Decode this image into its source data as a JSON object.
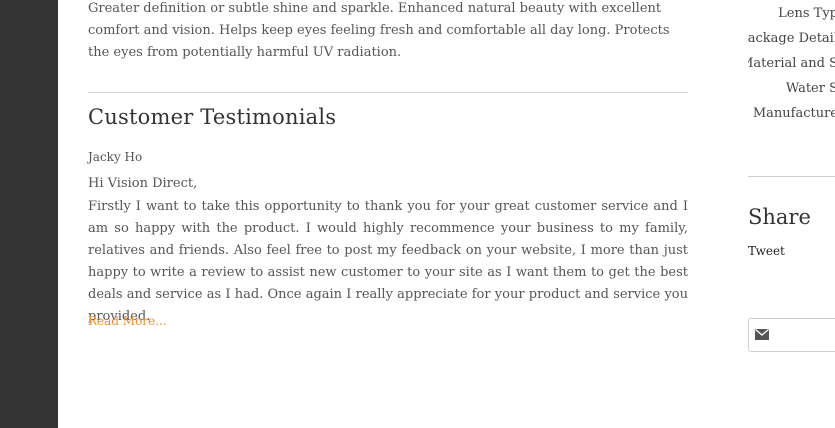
{
  "main": {
    "intro_text": "Greater definition or subtle shine and sparkle. Enhanced natural beauty with excellent comfort and vision. Helps keep eyes feeling fresh and comfortable all day long. Protects the eyes from potentially harmful UV radiation.",
    "section_title": "Customer Testimonials",
    "testimonial": {
      "author": "Jacky Ho",
      "greeting": "Hi Vision Direct,",
      "body": "Firstly I want to take this opportunity to thank you for your great customer service and I am so happy with the product. I would highly recommence your business to my family, relatives and friends. Also feel free to post my feedback on your website, I more than just happy to write a review to assist new customer to your site as I want them to get the best deals and service as I had. Once again I really appreciate for your product and service you provided.",
      "read_more": "Read More..."
    }
  },
  "sidebar": {
    "spec_items": [
      "Lens Typ",
      "Package Detail",
      "Material and S",
      "Water S",
      "Manufacture"
    ],
    "share_title": "Share",
    "tweet_label": "Tweet",
    "email_icon": "envelope-icon"
  },
  "colors": {
    "left_rail": "#333333",
    "text": "#555555",
    "link_accent": "#e9902e",
    "divider": "#cfcfcf"
  }
}
